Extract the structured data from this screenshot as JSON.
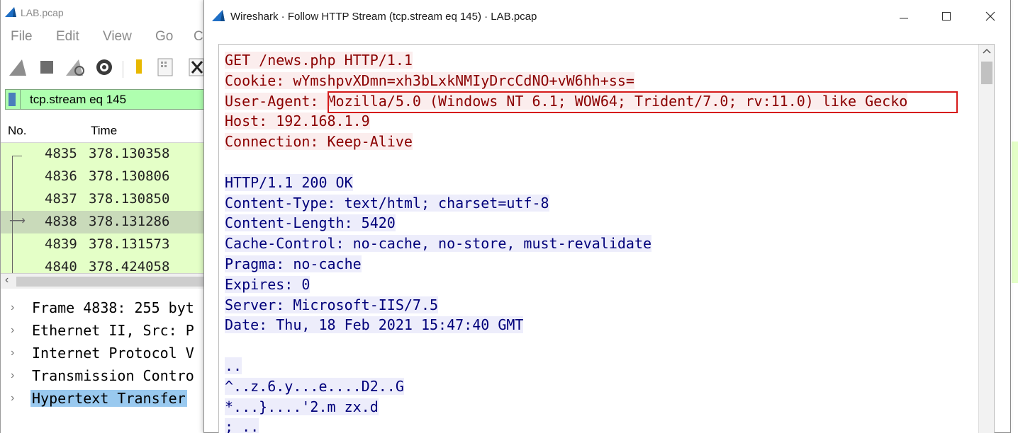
{
  "main_window": {
    "title": "LAB.pcap",
    "menu": [
      "File",
      "Edit",
      "View",
      "Go",
      "C"
    ],
    "filter": "tcp.stream eq 145",
    "columns": {
      "no": "No.",
      "time": "Time"
    },
    "packets": [
      {
        "no": "4835",
        "time": "378.130358"
      },
      {
        "no": "4836",
        "time": "378.130806"
      },
      {
        "no": "4837",
        "time": "378.130850"
      },
      {
        "no": "4838",
        "time": "378.131286"
      },
      {
        "no": "4839",
        "time": "378.131573"
      },
      {
        "no": "4840",
        "time": "378.424058"
      }
    ],
    "selected_packet": "4838",
    "details": [
      "Frame 4838: 255 byt",
      "Ethernet II, Src: P",
      "Internet Protocol V",
      "Transmission Contro",
      "Hypertext Transfer"
    ]
  },
  "dialog": {
    "title": "Wireshark · Follow HTTP Stream (tcp.stream eq 145) · LAB.pcap",
    "buttons": {
      "minimize": "—",
      "maximize": "☐",
      "close": "✕"
    },
    "colors": {
      "client_text": "#8b0000",
      "client_bg": "#fbeded",
      "server_text": "#00007a",
      "server_bg": "#ededfb",
      "highlight_box": "#d61a1a"
    },
    "request": {
      "request_line": "GET /news.php HTTP/1.1",
      "cookie": "Cookie: wYmshpvXDmn=xh3bLxkNMIyDrcCdNO+vW6hh+ss=",
      "ua_key": "User-Agent: ",
      "ua_value": "Mozilla/5.0 (Windows NT 6.1; WOW64; Trident/7.0; rv:11.0) like Gecko",
      "host": "Host: 192.168.1.9",
      "connection": "Connection: Keep-Alive"
    },
    "response": {
      "status": "HTTP/1.1 200 OK",
      "content_type": "Content-Type: text/html; charset=utf-8",
      "content_length": "Content-Length: 5420",
      "cache_control": "Cache-Control: no-cache, no-store, must-revalidate",
      "pragma": "Pragma: no-cache",
      "expires": "Expires: 0",
      "server": "Server: Microsoft-IIS/7.5",
      "date": "Date: Thu, 18 Feb 2021 15:47:40 GMT"
    },
    "body": [
      "..",
      "^..z.6.y...e....D2..G",
      "*...}....'2.m zx.d",
      ";_.."
    ]
  }
}
